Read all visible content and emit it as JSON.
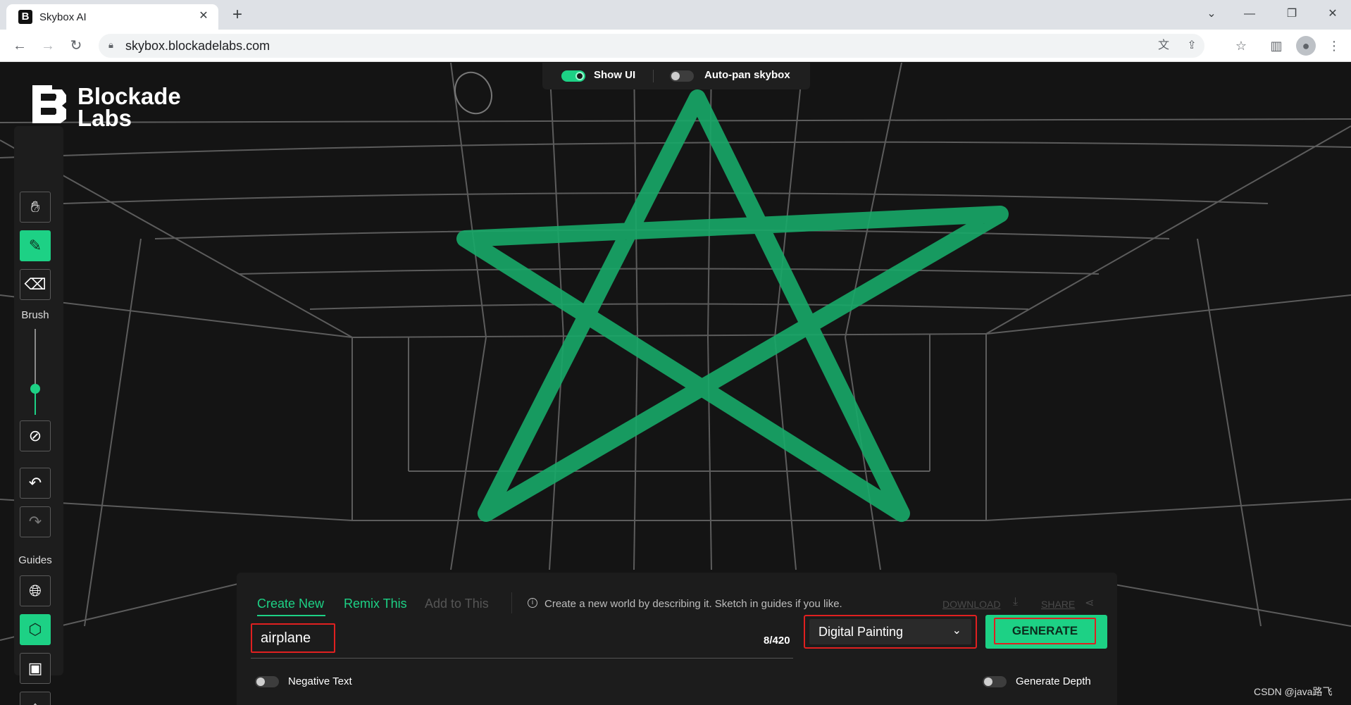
{
  "browser": {
    "tab_title": "Skybox AI",
    "tab_favicon": "B",
    "url": "skybox.blockadelabs.com",
    "icons": [
      "back-icon",
      "forward-icon",
      "reload-icon",
      "lock-icon",
      "translate-icon",
      "share-icon",
      "star-icon",
      "sidepanel-icon",
      "profile-icon",
      "menu-icon"
    ]
  },
  "logo": {
    "line1": "Blockade",
    "line2": "Labs"
  },
  "top_toggles": {
    "show_ui": {
      "label": "Show UI",
      "on": true
    },
    "auto_pan": {
      "label": "Auto-pan skybox",
      "on": false
    }
  },
  "sidebar": {
    "brush_label": "Brush",
    "brush_size": 0.3,
    "guides_label": "Guides",
    "tools": [
      "hand-icon",
      "brush-icon",
      "eraser-icon",
      "clear-icon",
      "undo-icon",
      "redo-icon",
      "globe-icon",
      "cube-icon",
      "image-icon",
      "mesh-icon"
    ]
  },
  "panel": {
    "tabs": {
      "create": "Create New",
      "remix": "Remix This",
      "add": "Add to This"
    },
    "hint": "Create a new world by describing it. Sketch in guides if you like.",
    "download": "DOWNLOAD",
    "share": "SHARE",
    "prompt_value": "airplane",
    "counter": "8/420",
    "style": "Digital Painting",
    "generate": "GENERATE",
    "negative_text": "Negative Text",
    "generate_depth": "Generate Depth"
  },
  "colors": {
    "accent": "#1dd185",
    "highlight": "#e02020",
    "background": "#141414"
  },
  "watermark": "CSDN @java路飞"
}
